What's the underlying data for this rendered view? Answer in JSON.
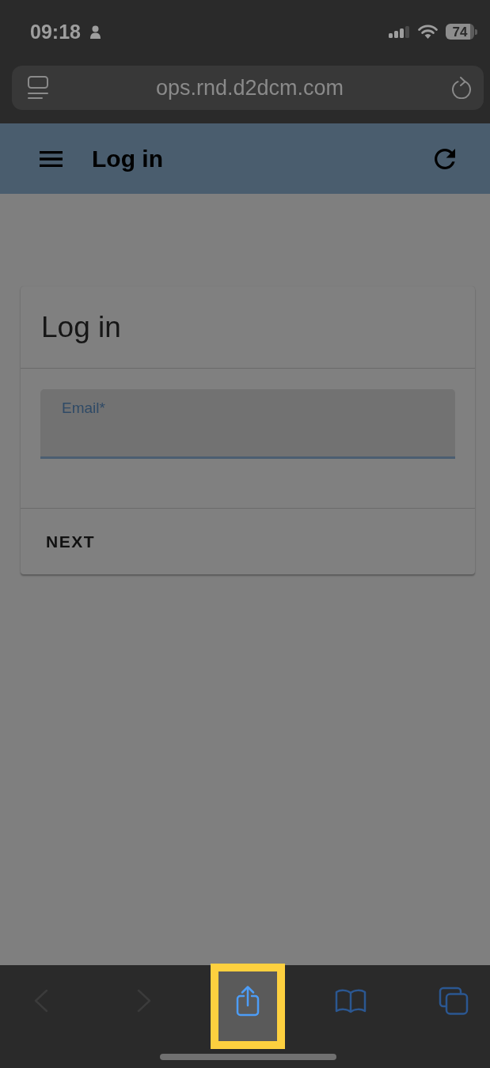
{
  "status_bar": {
    "time": "09:18",
    "battery": "74"
  },
  "address_bar": {
    "url": "ops.rnd.d2dcm.com"
  },
  "app_bar": {
    "title": "Log in"
  },
  "login_card": {
    "title": "Log in",
    "email_field": {
      "label": "Email*",
      "focused": true
    },
    "next_button": "NEXT"
  },
  "toolbar": {
    "items": [
      {
        "kind": "back",
        "disabled": true,
        "highlighted": false
      },
      {
        "kind": "forward",
        "disabled": true,
        "highlighted": false
      },
      {
        "kind": "share",
        "disabled": false,
        "highlighted": true
      },
      {
        "kind": "bookmarks",
        "disabled": false,
        "highlighted": false
      },
      {
        "kind": "tabs",
        "disabled": false,
        "highlighted": false
      }
    ]
  }
}
